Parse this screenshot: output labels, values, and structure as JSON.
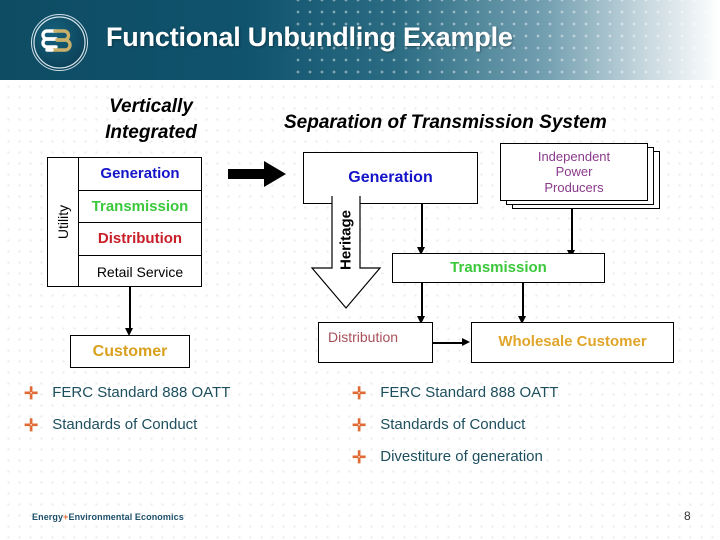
{
  "header": {
    "title": "Functional Unbundling Example",
    "logo_icon": "e3-circle-logo"
  },
  "left_panel": {
    "title": "Vertically Integrated",
    "utility_label": "Utility",
    "rows": [
      {
        "label": "Generation",
        "color": "#1414c8"
      },
      {
        "label": "Transmission",
        "color": "#3cc83c"
      },
      {
        "label": "Distribution",
        "color": "#c81e28"
      },
      {
        "label": "Retail Service",
        "color": "#000000",
        "weight": "normal"
      }
    ],
    "customer_box": {
      "label": "Customer",
      "color": "#d9a01e"
    },
    "bullets": [
      "FERC Standard 888 OATT",
      "Standards of Conduct"
    ]
  },
  "right_panel": {
    "title": "Separation of Transmission System",
    "generation_box": {
      "label": "Generation",
      "color": "#1414c8"
    },
    "ipp_box": {
      "label": "Independent\nPower\nProducers",
      "lines": [
        "Independent",
        "Power",
        "Producers"
      ],
      "color": "#8b3a8b"
    },
    "heritage_arrow": {
      "label": "Heritage"
    },
    "transmission_box": {
      "label": "Transmission",
      "color": "#3cc83c"
    },
    "distribution_box": {
      "label": "Distribution",
      "color": "#a8505a"
    },
    "wholesale_box": {
      "label": "Wholesale Customer",
      "color": "#e0a52a"
    },
    "bullets": [
      "FERC Standard 888 OATT",
      "Standards of Conduct",
      "Divestiture of generation"
    ]
  },
  "footer": {
    "brand_pre": "Energy",
    "brand_plus": "+",
    "brand_post": "Environmental Economics",
    "page_number": "8"
  },
  "colors": {
    "header_dark": "#0e4c63",
    "bullet_mark": "#e06b34",
    "bullet_text": "#1d4f5e"
  }
}
